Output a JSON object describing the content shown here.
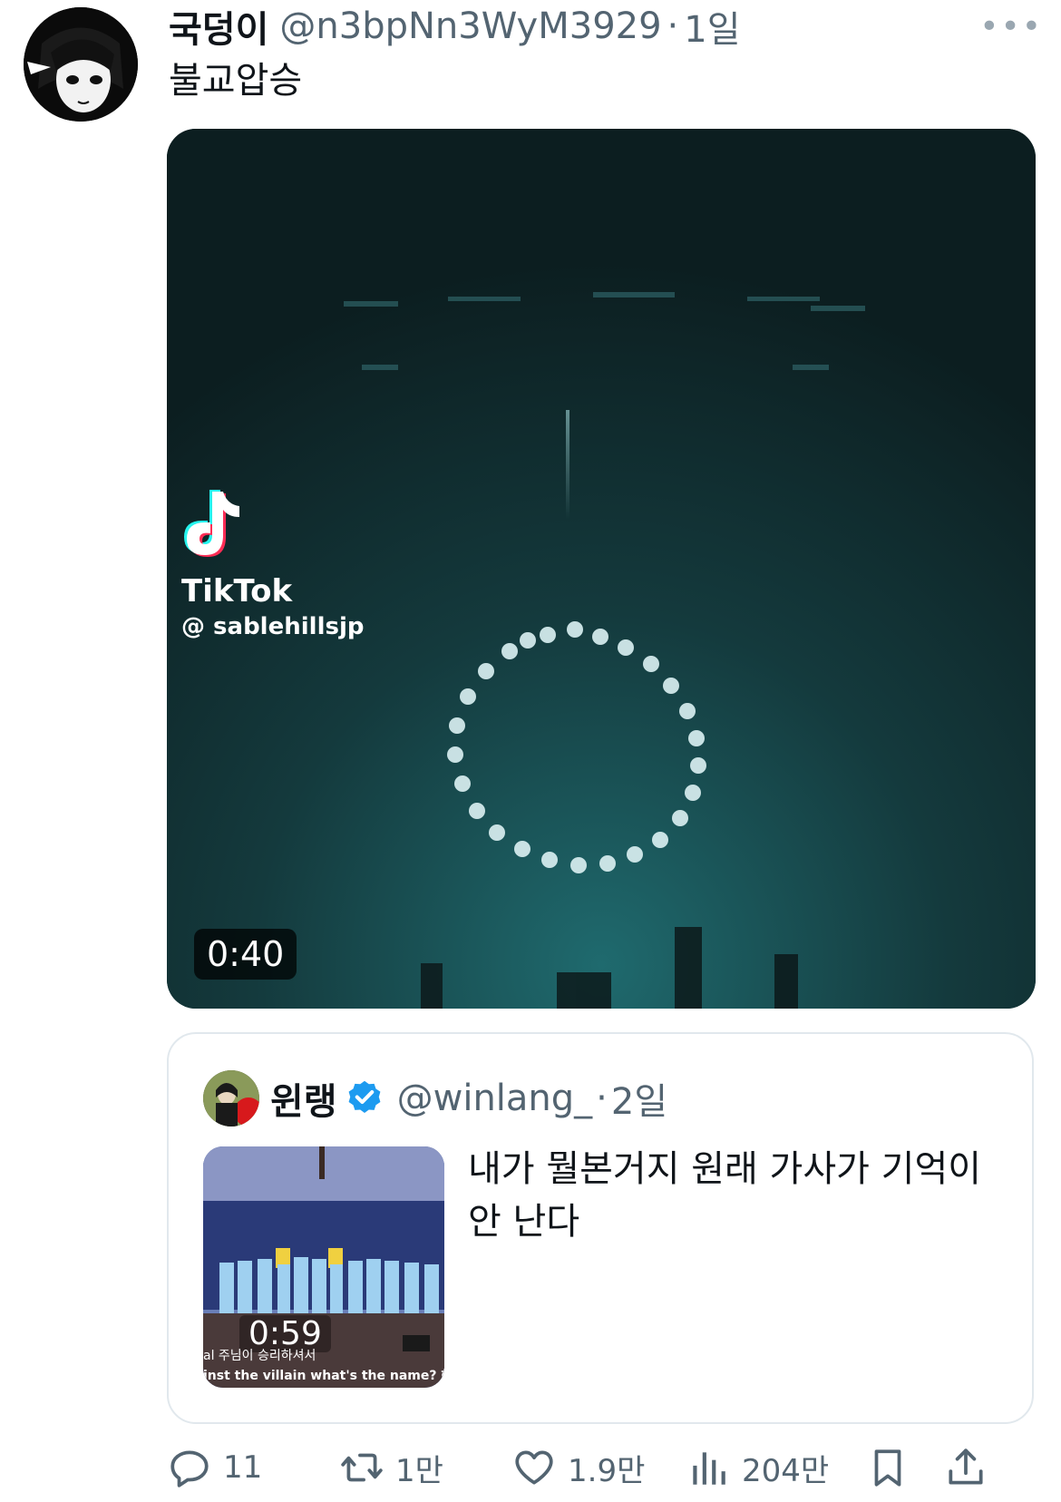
{
  "tweet": {
    "display_name": "국덩이",
    "handle": "@n3bpNn3WyM3929",
    "separator": "·",
    "time": "1일",
    "more_label": "•••",
    "text": "불교압승",
    "media": {
      "watermark_brand": "TikTok",
      "watermark_user": "@ sablehillsjp",
      "duration": "0:40"
    }
  },
  "quote": {
    "display_name": "윈랭",
    "handle": "@winlang_",
    "separator": "·",
    "time": "2일",
    "text": "내가 뭘본거지 원래 가사가 기억이 안 난다",
    "thumb": {
      "duration": "0:59",
      "caption_line1": "al 주님이 승리하셔서",
      "caption_line2": "inst the villain what's the name? 헤롯 군"
    }
  },
  "actions": {
    "reply_count": "11",
    "retweet_count": "1만",
    "like_count": "1.9만",
    "views_count": "204만"
  },
  "colors": {
    "text_primary": "#0f1419",
    "text_secondary": "#536471",
    "verified_blue": "#1d9bf0",
    "video_bg": "#0f2a2c"
  },
  "icons": [
    "more-icon",
    "tiktok-logo-icon",
    "verified-badge-icon",
    "reply-icon",
    "retweet-icon",
    "like-icon",
    "views-icon",
    "bookmark-icon",
    "share-icon"
  ]
}
